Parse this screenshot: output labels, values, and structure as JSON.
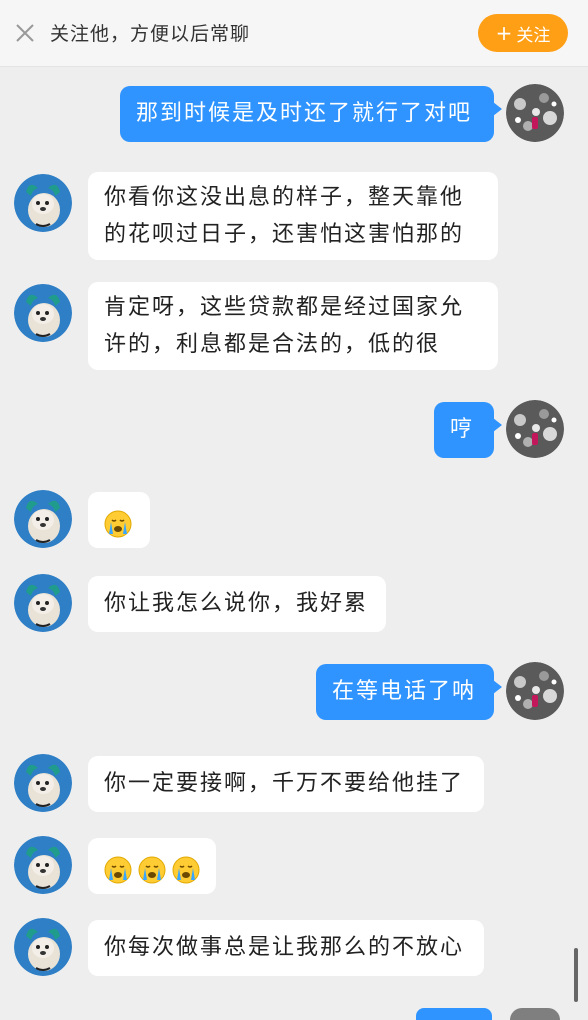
{
  "header": {
    "close_icon": "close-icon",
    "prompt": "关注他，方便以后常聊",
    "follow_label": "关注",
    "follow_color": "#ff9f16"
  },
  "colors": {
    "out_bubble": "#2f94ff",
    "in_bubble": "#ffffff",
    "background": "#eeeeee"
  },
  "messages": [
    {
      "side": "out",
      "lines": [
        "那到时候是及时还了就行了对吧"
      ]
    },
    {
      "side": "in",
      "lines": [
        "你看你这没出息的样子，整天靠他",
        "的花呗过日子，还害怕这害怕那的"
      ]
    },
    {
      "side": "in",
      "lines": [
        "肯定呀，这些贷款都是经过国家允",
        "许的，利息都是合法的，低的很"
      ]
    },
    {
      "side": "out",
      "lines": [
        "哼"
      ]
    },
    {
      "side": "in",
      "emoji": "crying-face",
      "emoji_count": 1
    },
    {
      "side": "in",
      "lines": [
        "你让我怎么说你，我好累"
      ]
    },
    {
      "side": "out",
      "lines": [
        "在等电话了呐"
      ]
    },
    {
      "side": "in",
      "lines": [
        "你一定要接啊，千万不要给他挂了"
      ]
    },
    {
      "side": "in",
      "emoji": "crying-face",
      "emoji_count": 3
    },
    {
      "side": "in",
      "lines": [
        "你每次做事总是让我那么的不放心"
      ]
    }
  ]
}
